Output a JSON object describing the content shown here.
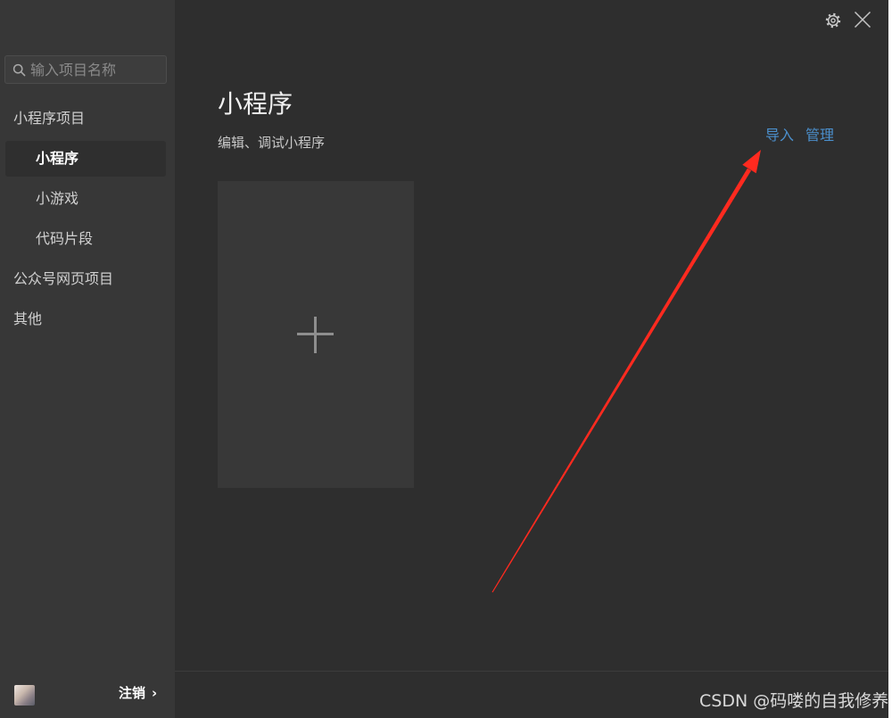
{
  "window": {
    "controls": {
      "settings_icon": "gear-icon",
      "close_icon": "close-icon"
    }
  },
  "sidebar": {
    "search": {
      "placeholder": "输入项目名称",
      "icon": "search-icon"
    },
    "items": [
      {
        "label": "小程序项目",
        "level": 0,
        "selected": false
      },
      {
        "label": "小程序",
        "level": 1,
        "selected": true
      },
      {
        "label": "小游戏",
        "level": 1,
        "selected": false
      },
      {
        "label": "代码片段",
        "level": 1,
        "selected": false
      },
      {
        "label": "公众号网页项目",
        "level": 0,
        "selected": false
      },
      {
        "label": "其他",
        "level": 0,
        "selected": false
      }
    ],
    "footer": {
      "logout_label": "注销",
      "chevron": "›"
    }
  },
  "main": {
    "title": "小程序",
    "subtitle": "编辑、调试小程序",
    "actions": [
      {
        "label": "导入"
      },
      {
        "label": "管理"
      }
    ],
    "new_project_card": {
      "icon": "plus-icon"
    }
  },
  "annotation": {
    "arrow_color": "#ff2a1f"
  },
  "watermark": "CSDN @码喽的自我修养",
  "colors": {
    "sidebar_bg": "#373737",
    "main_bg": "#2e2e2e",
    "selected_bg": "#2f2f2f",
    "card_bg": "#383838",
    "link": "#4b8fcc",
    "text": "#d0d0d0"
  }
}
